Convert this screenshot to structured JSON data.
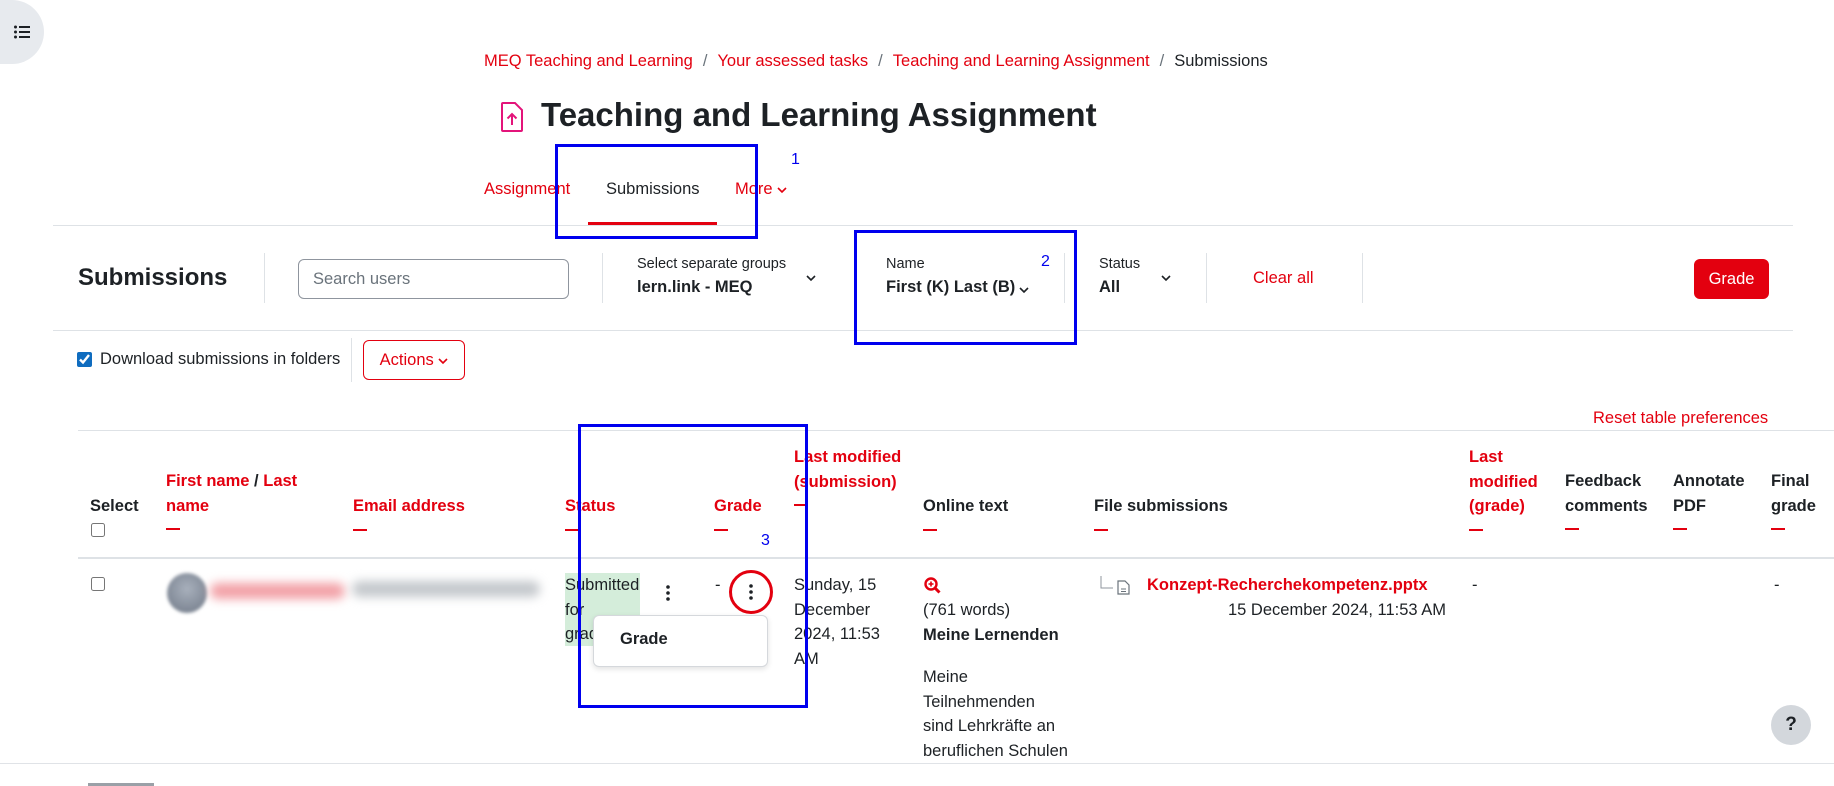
{
  "breadcrumb": [
    "MEQ Teaching and Learning",
    "Your assessed tasks",
    "Teaching and Learning Assignment",
    "Submissions"
  ],
  "page_title": "Teaching and Learning Assignment",
  "nav": {
    "assignment": "Assignment",
    "submissions": "Submissions",
    "more": "More"
  },
  "action_bar": {
    "heading": "Submissions",
    "search_placeholder": "Search users",
    "groups_label": "Select separate groups",
    "groups_value": "lern.link - MEQ",
    "name_label": "Name",
    "name_value": "First (K) Last (B)",
    "status_label": "Status",
    "status_value": "All",
    "clear_all": "Clear all",
    "grade_button": "Grade"
  },
  "options": {
    "download_label": "Download submissions in folders",
    "download_checked": true,
    "actions_label": "Actions"
  },
  "reset_table": "Reset table preferences",
  "table": {
    "headers": {
      "select": "Select",
      "first_name": "First name",
      "slash": "/",
      "last_name": "Last name",
      "email": "Email address",
      "status": "Status",
      "grade": "Grade",
      "last_modified_submission": "Last modified (submission)",
      "online_text": "Online text",
      "file_submissions": "File submissions",
      "last_modified_grade": "Last modified (grade)",
      "feedback_comments": "Feedback comments",
      "annotate_pdf": "Annotate PDF",
      "final_grade": "Final grade"
    },
    "row": {
      "status_lines": [
        "Submitted",
        "for",
        "grad"
      ],
      "grade_value": "-",
      "last_modified_lines": [
        "Sunday, 15",
        "December",
        "2024, 11:53",
        "AM"
      ],
      "online_text_words": "(761 words)",
      "online_text_title": "Meine Lernenden",
      "online_text_body": [
        "Meine",
        "Teilnehmenden",
        "sind Lehrkräfte an",
        "beruflichen Schulen"
      ],
      "file_name": "Konzept-Recherchekompetenz.pptx",
      "file_date": "15 December 2024, 11:53 AM",
      "last_modified_grade": "-",
      "final_grade": "-"
    },
    "grade_menu_item": "Grade"
  },
  "annotations": [
    "1",
    "2",
    "3"
  ],
  "help": "?",
  "colors": {
    "brand": "#e3000f",
    "annotation": "#0000ee",
    "status_submitted_bg": "#d4edda"
  }
}
